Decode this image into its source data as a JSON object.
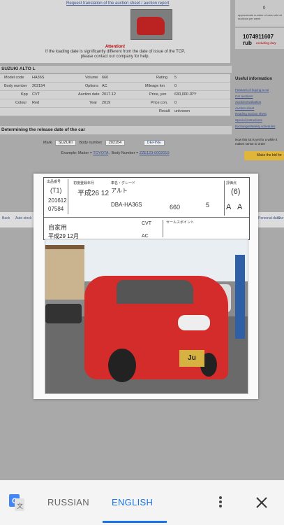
{
  "page": {
    "top_link": "Request translation of the auction sheet / auction report",
    "attention_title": "Attention!",
    "attention_line1": "If the loading date is significantly different from the date of issue of the TCP,",
    "attention_line2": "please contact our company for help.",
    "table_title": "SUZUKI ALTO L",
    "table_rows": [
      [
        "Model code",
        "HA36S",
        "Volume",
        "660",
        "Rating",
        "5"
      ],
      [
        "Body number",
        "202154",
        "Options",
        "AC",
        "Mileage km",
        "0"
      ],
      [
        "Kpp",
        "CVT",
        "Auction date",
        "2017.12",
        "Price, yen",
        "630,000 JPY"
      ],
      [
        "Colour",
        "Red",
        "Year",
        "2019",
        "Price con.",
        "0"
      ],
      [
        "",
        "",
        "",
        "",
        "Result",
        "unknown"
      ]
    ],
    "release_title": "Determining the release date of the car",
    "mark_label": "Mark",
    "mark_value": "SUZUKI",
    "body_label": "Body number",
    "body_value": "202154",
    "define_label": "DEFINE",
    "example_text": "Example: Maker =",
    "example_maker": "TOYOTA",
    "example_body_text": ", Body Number =",
    "example_body": "ZZE123-0002010",
    "band_left": "Back",
    "band_mid": "Auto stock",
    "band_right": "Personal data",
    "band_far": "Our"
  },
  "sidebar": {
    "count": "0",
    "count_note": "approximate number of cars sold at auctions per week",
    "price_rub": "1074911607 rub",
    "price_note": "excluding duty",
    "useful_title": "Useful information",
    "useful_links": [
      "Features of buying a car",
      "Car auctions",
      "Auction Evaluation",
      "Auction sheet",
      "Reading auction sheet",
      "Special instructions",
      "Exchange/Weekly schedules"
    ],
    "note": "Now this lot is yet for a while it makes sense to order",
    "make_bid": "Make the bid for"
  },
  "sheet": {
    "lot_label": "出品番号",
    "lot_num": "(T1)",
    "date": "201612",
    "lot_id": "07584",
    "year_label": "初度登録年月",
    "year_value": "平成26 12",
    "model_label": "車名・グレード",
    "model_value": "アルト",
    "model_code": "DBA-HA36S",
    "cc": "660",
    "doors": "5",
    "grade_label": "評価点",
    "grade": "(6)",
    "score_a": "A",
    "score_b": "A",
    "use": "自家用",
    "reg": "平成29 12月",
    "shift": "CVT",
    "ac": "AC",
    "notes_label": "セールスポイント",
    "plate_text": "Ju"
  },
  "translate_bar": {
    "source_lang": "RUSSIAN",
    "target_lang": "ENGLISH"
  },
  "colors": {
    "accent": "#1a73e8"
  }
}
